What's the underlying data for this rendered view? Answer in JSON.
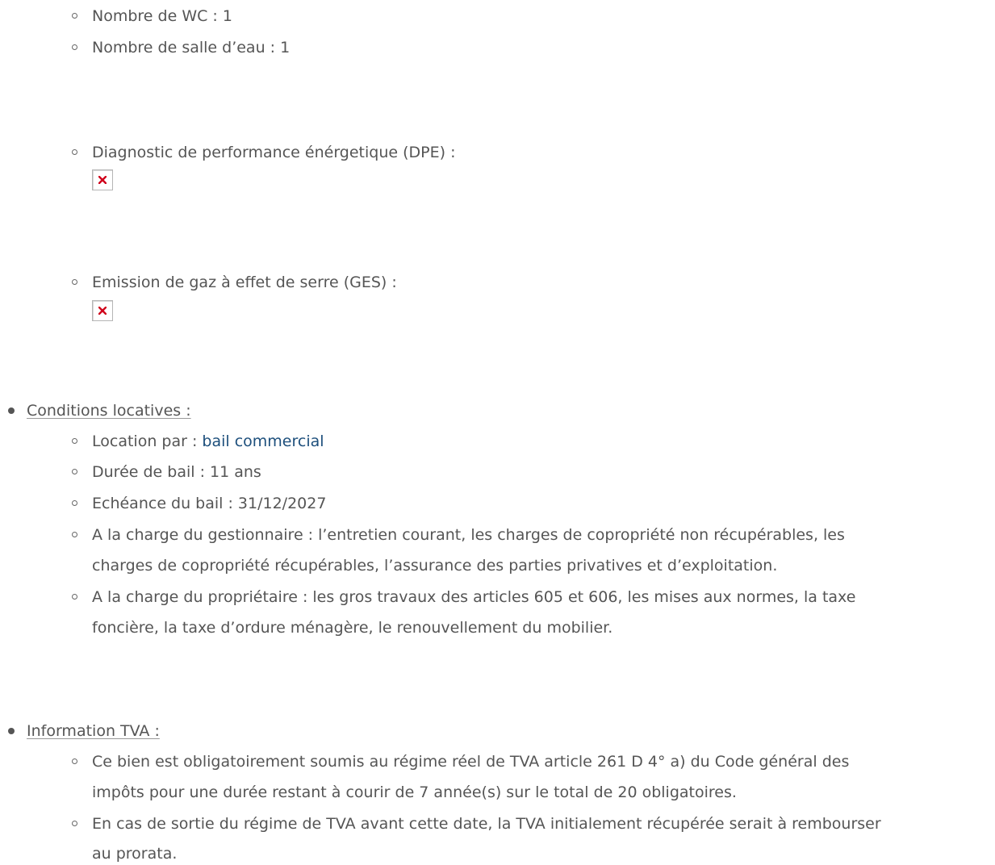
{
  "caracteristiques": {
    "wc": "Nombre de WC : 1",
    "salle_eau": "Nombre de salle d’eau : 1",
    "dpe": "Diagnostic de performance énérgetique (DPE) :",
    "ges": "Emission de gaz à effet de serre (GES) :",
    "broken_image_icon": "broken-image-icon"
  },
  "conditions": {
    "heading": "Conditions locatives :",
    "location_label": "Location par : ",
    "location_link": "bail commercial",
    "duree": "Durée de bail : 11 ans",
    "echeance": "Echéance du bail : 31/12/2027",
    "gestionnaire_l1": "A la charge du gestionnaire : l’entretien courant, les charges de copropriété non récupérables, les",
    "gestionnaire_l2": "charges de copropriété récupérables, l’assurance des parties privatives et d’exploitation.",
    "proprietaire_l1": "A la charge du propriétaire : les gros travaux des articles 605 et 606, les mises aux normes, la taxe",
    "proprietaire_l2": "foncière, la taxe d’ordure ménagère, le renouvellement du mobilier."
  },
  "tva": {
    "heading": "Information TVA :",
    "item1_l1": "Ce bien est obligatoirement soumis au régime réel de TVA article 261 D 4° a) du Code général des",
    "item1_l2": "impôts pour une durée restant à courir de 7 année(s) sur le total de 20 obligatoires.",
    "item2_l1": "En cas de sortie du régime de TVA avant cette date, la TVA initialement récupérée serait à rembourser",
    "item2_l2": "au prorata."
  },
  "colors": {
    "text": "#555555",
    "link": "#1d4f7c",
    "broken_x": "#d0021b"
  }
}
